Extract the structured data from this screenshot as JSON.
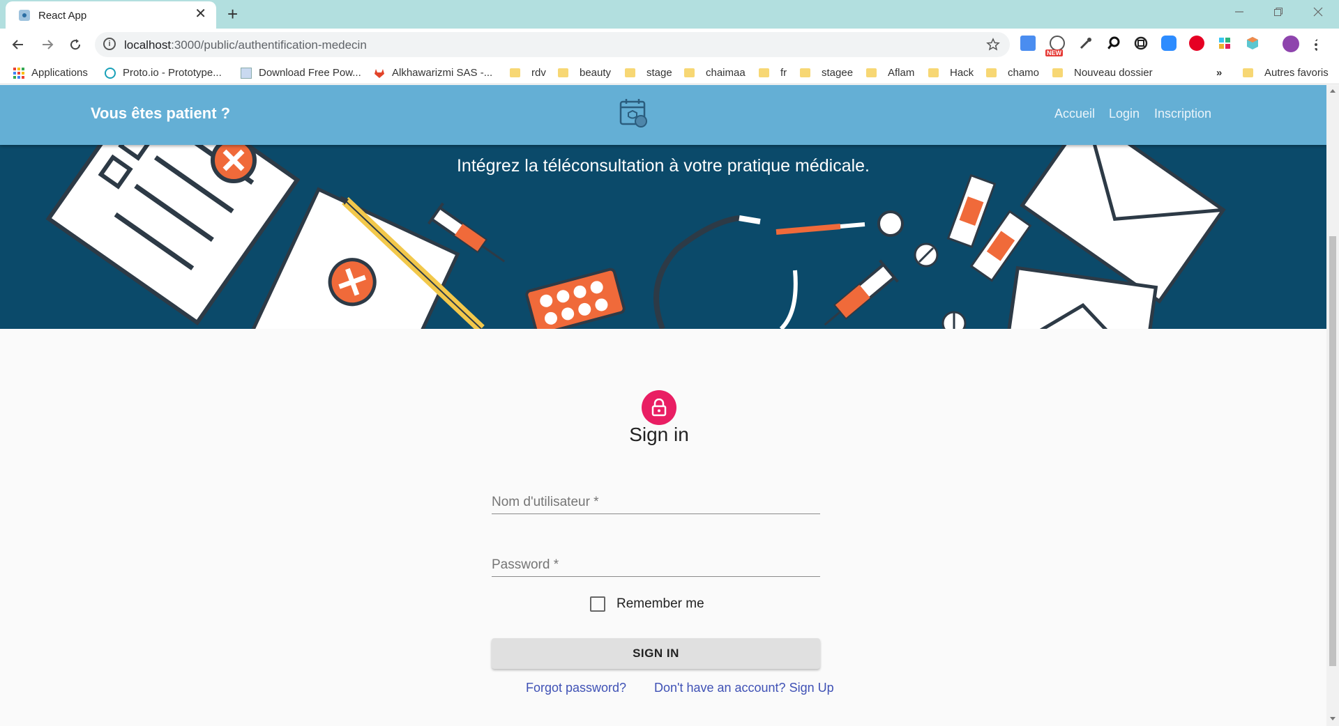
{
  "browser": {
    "tab_title": "React App",
    "new_tab_symbol": "+",
    "tab_close_symbol": "✕",
    "url_host": "localhost",
    "url_rest": ":3000/public/authentification-medecin",
    "extension_badge": "NEW",
    "bookmarks": [
      {
        "label": "Applications",
        "icon": "apps-grid-icon"
      },
      {
        "label": "Proto.io - Prototype...",
        "icon": "protoio-icon"
      },
      {
        "label": "Download Free Pow...",
        "icon": "page-icon"
      },
      {
        "label": "Alkhawarizmi SAS -...",
        "icon": "gitlab-icon"
      },
      {
        "label": "rdv",
        "icon": "folder-icon"
      },
      {
        "label": "beauty",
        "icon": "folder-icon"
      },
      {
        "label": "stage",
        "icon": "folder-icon"
      },
      {
        "label": "chaimaa",
        "icon": "folder-icon"
      },
      {
        "label": "fr",
        "icon": "folder-icon"
      },
      {
        "label": "stagee",
        "icon": "folder-icon"
      },
      {
        "label": "Aflam",
        "icon": "folder-icon"
      },
      {
        "label": "Hack",
        "icon": "folder-icon"
      },
      {
        "label": "chamo",
        "icon": "folder-icon"
      },
      {
        "label": "Nouveau dossier",
        "icon": "folder-icon"
      }
    ],
    "bookmarks_overflow": "»",
    "other_bookmarks": "Autres favoris"
  },
  "appbar": {
    "title": "Vous êtes patient ?",
    "links": [
      "Accueil",
      "Login",
      "Inscription"
    ]
  },
  "banner": {
    "headline": "Intégrez la téléconsultation à votre pratique médicale."
  },
  "signin": {
    "title": "Sign in",
    "username_label": "Nom d'utilisateur *",
    "password_label": "Password *",
    "remember_label": "Remember me",
    "button_label": "SIGN IN",
    "forgot_link": "Forgot password?",
    "signup_link": "Don't have an account? Sign Up"
  },
  "colors": {
    "appbar": "#64afd5",
    "banner": "#0b4a6a",
    "lock_avatar": "#e91e63",
    "link": "#3f51b5",
    "tabstrip": "#b2dfdf"
  }
}
